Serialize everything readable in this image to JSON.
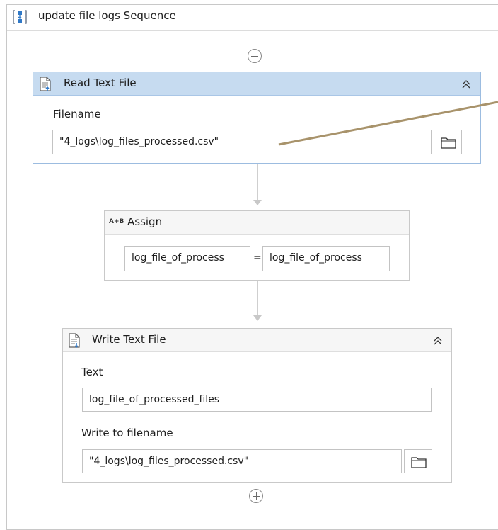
{
  "sequence": {
    "title": "update file logs Sequence",
    "icon": "sequence-icon"
  },
  "activities": {
    "read_text_file": {
      "title": "Read Text File",
      "icon": "read-file-icon",
      "collapse_glyph": "≪",
      "filename_label": "Filename",
      "filename_value": "\"4_logs\\log_files_processed.csv\"",
      "browse_icon": "folder-icon"
    },
    "assign": {
      "title": "Assign",
      "icon_text": "A+B",
      "left_value": "log_file_of_process",
      "operator": "=",
      "right_value": "log_file_of_process"
    },
    "write_text_file": {
      "title": "Write Text File",
      "icon": "write-file-icon",
      "text_label": "Text",
      "text_value": "log_file_of_processed_files",
      "filename_label": "Write to filename",
      "filename_value": "\"4_logs\\log_files_processed.csv\"",
      "browse_icon": "folder-icon"
    }
  },
  "colors": {
    "selected_header": "#c6dbf0",
    "annotation_line": "#a8936b"
  }
}
